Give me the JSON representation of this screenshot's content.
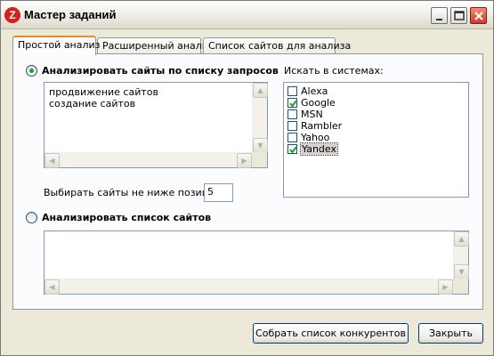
{
  "window": {
    "title": "Мастер заданий"
  },
  "tabs": [
    {
      "label": "Простой анализ",
      "active": true
    },
    {
      "label": "Расширенный анализ",
      "active": false
    },
    {
      "label": "Список сайтов для анализа",
      "active": false
    }
  ],
  "query_mode": {
    "label": "Анализировать сайты по списку запросов",
    "selected": true,
    "queries": [
      "продвижение сайтов",
      "создание сайтов"
    ]
  },
  "position": {
    "label": "Выбирать сайты не ниже позиции:",
    "value": "5"
  },
  "search_engines": {
    "label": "Искать в системах:",
    "items": [
      {
        "name": "Alexa",
        "checked": false
      },
      {
        "name": "Google",
        "checked": true
      },
      {
        "name": "MSN",
        "checked": false
      },
      {
        "name": "Rambler",
        "checked": false
      },
      {
        "name": "Yahoo",
        "checked": false
      },
      {
        "name": "Yandex",
        "checked": true,
        "selected": true
      }
    ]
  },
  "site_mode": {
    "label": "Анализировать список сайтов",
    "selected": false,
    "sites": []
  },
  "buttons": {
    "collect": "Собрать список конкурентов",
    "close": "Закрыть"
  },
  "icons": {
    "app": "app-logo-icon",
    "minimize": "minimize-icon",
    "maximize": "maximize-icon",
    "close": "close-icon",
    "check": "checkmark-icon"
  },
  "colors": {
    "tab_highlight": "#e68b2c",
    "radio_dot": "#21a121",
    "checkmark": "#21a121",
    "close_button": "#c73e27"
  }
}
